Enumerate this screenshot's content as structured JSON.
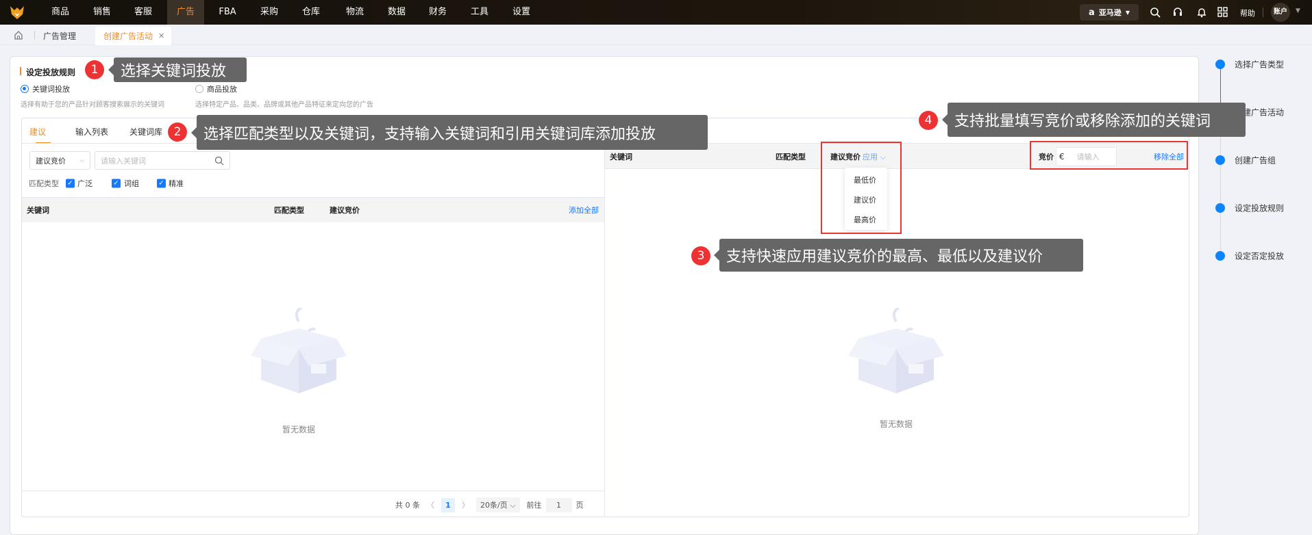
{
  "nav": {
    "items": [
      "商品",
      "销售",
      "客服",
      "广告",
      "FBA",
      "采购",
      "仓库",
      "物流",
      "数据",
      "财务",
      "工具",
      "设置"
    ],
    "active_index": 3,
    "marketplace": "亚马逊",
    "help": "帮助",
    "account": "账户"
  },
  "breadcrumb": {
    "parent": "广告管理",
    "tab": "创建广告活动",
    "close": "✕"
  },
  "rules": {
    "title": "设定投放规则",
    "options": [
      {
        "label": "关键词投放",
        "desc": "选择有助于您的产品针对顾客搜索展示的关键词",
        "selected": true
      },
      {
        "label": "商品投放",
        "desc": "选择特定产品、品类、品牌或其他产品特征来定向您的广告",
        "selected": false
      }
    ]
  },
  "left": {
    "tabs": [
      "建议",
      "输入列表",
      "关键词库"
    ],
    "active_tab": 0,
    "sort_select": "建议竞价",
    "search_placeholder": "请输入关键词",
    "match_label": "匹配类型",
    "match_types": [
      "广泛",
      "词组",
      "精准"
    ],
    "columns": [
      "关键词",
      "匹配类型",
      "建议竞价"
    ],
    "add_all": "添加全部",
    "empty": "暂无数据",
    "pagination": {
      "total": "共 0 条",
      "page": "1",
      "page_size": "20条/页",
      "goto": "前往",
      "goto_value": "1",
      "page_unit": "页"
    }
  },
  "right": {
    "columns": [
      "关键词",
      "匹配类型",
      "建议竞价"
    ],
    "apply": "应用",
    "apply_options": [
      "最低价",
      "建议价",
      "最高价"
    ],
    "bid_label": "竞价",
    "currency": "€",
    "bid_placeholder": "请输入",
    "remove_all": "移除全部",
    "empty": "暂无数据"
  },
  "steps": [
    "选择广告类型",
    "创建广告活动",
    "创建广告组",
    "设定投放规则",
    "设定否定投放"
  ],
  "annotations": [
    {
      "n": "1",
      "text": "选择关键词投放"
    },
    {
      "n": "2",
      "text": "选择匹配类型以及关键词，支持输入关键词和引用关键词库添加投放"
    },
    {
      "n": "3",
      "text": "支持快速应用建议竞价的最高、最低以及建议价"
    },
    {
      "n": "4",
      "text": "支持批量填写竞价或移除添加的关键词"
    }
  ],
  "colors": {
    "accent": "#f08c1e",
    "primary": "#1677ff",
    "annotation_red": "#ee3234"
  }
}
